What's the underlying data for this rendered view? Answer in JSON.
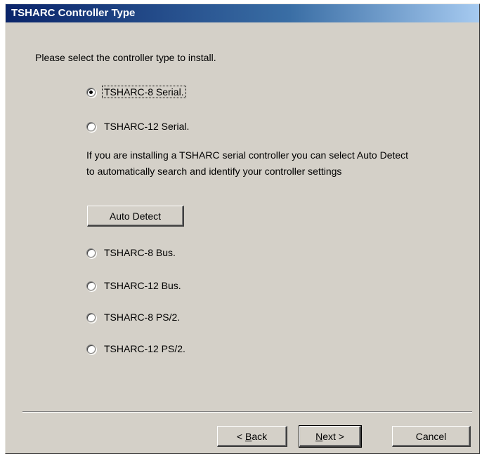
{
  "window": {
    "title": "TSHARC Controller Type"
  },
  "prompt": "Please select the controller type to install.",
  "options": [
    {
      "label": "TSHARC-8 Serial.",
      "checked": true
    },
    {
      "label": "TSHARC-12 Serial.",
      "checked": false
    },
    {
      "label": "TSHARC-8 Bus.",
      "checked": false
    },
    {
      "label": "TSHARC-12 Bus.",
      "checked": false
    },
    {
      "label": "TSHARC-8 PS/2.",
      "checked": false
    },
    {
      "label": "TSHARC-12 PS/2.",
      "checked": false
    }
  ],
  "info_text": "If you are installing a TSHARC serial controller you can select Auto Detect to automatically search and identify your controller settings",
  "buttons": {
    "auto_detect": "Auto Detect",
    "back_prefix": "< ",
    "back_mnemonic": "B",
    "back_rest": "ack",
    "next_mnemonic": "N",
    "next_rest": "ext >",
    "cancel": "Cancel"
  },
  "colors": {
    "titlebar_start": "#0a246a",
    "titlebar_end": "#a6caf0",
    "dialog_bg": "#d4d0c8"
  }
}
